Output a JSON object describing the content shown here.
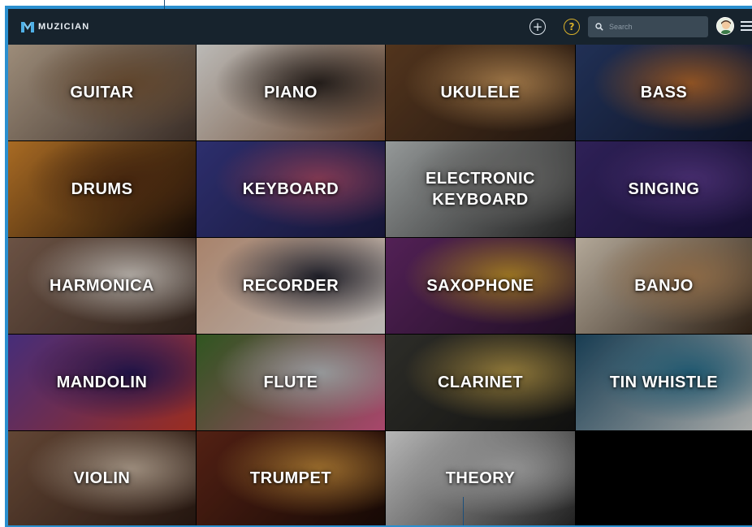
{
  "app": {
    "brand": "MUZICIAN"
  },
  "header": {
    "add_icon": "plus-circle-icon",
    "help_icon": "question-circle-icon",
    "help_glyph": "?",
    "add_glyph": "+",
    "search_placeholder": "Search",
    "menu_icon": "hamburger-menu-icon"
  },
  "colors": {
    "frame": "#2a8fcf",
    "topbar": "#17232d",
    "help": "#d8b02a"
  },
  "instruments": [
    {
      "label": "GUITAR",
      "c1": "#c9b49c",
      "c2": "#7c5a3a",
      "c3": "#4a3a32"
    },
    {
      "label": "PIANO",
      "c1": "#f0eeea",
      "c2": "#2e2622",
      "c3": "#8a5e40"
    },
    {
      "label": "UKULELE",
      "c1": "#6a4426",
      "c2": "#c8955a",
      "c3": "#2a1c14"
    },
    {
      "label": "BASS",
      "c1": "#2a3e6e",
      "c2": "#b76a2e",
      "c3": "#121a30"
    },
    {
      "label": "DRUMS",
      "c1": "#d8892e",
      "c2": "#5a3214",
      "c3": "#1c0f08"
    },
    {
      "label": "KEYBOARD",
      "c1": "#3a3c8c",
      "c2": "#a64a6a",
      "c3": "#1c1c46"
    },
    {
      "label": "ELECTRONIC\nKEYBOARD",
      "c1": "#bfc4c4",
      "c2": "#7c7c7a",
      "c3": "#2a2a2a"
    },
    {
      "label": "SINGING",
      "c1": "#3c2a70",
      "c2": "#5a3a8c",
      "c3": "#1c1440"
    },
    {
      "label": "HARMONICA",
      "c1": "#8a6a58",
      "c2": "#e0d8d0",
      "c3": "#3a2a22"
    },
    {
      "label": "RECORDER",
      "c1": "#d8a88a",
      "c2": "#2a2a36",
      "c3": "#f0ece8"
    },
    {
      "label": "SAXOPHONE",
      "c1": "#6a2a6e",
      "c2": "#c7962e",
      "c3": "#2a1430"
    },
    {
      "label": "BANJO",
      "c1": "#e6d8c4",
      "c2": "#b4885a",
      "c3": "#3a2a1c"
    },
    {
      "label": "MANDOLIN",
      "c1": "#5a3a9c",
      "c2": "#2a1a5c",
      "c3": "#c73a2a"
    },
    {
      "label": "FLUTE",
      "c1": "#3e6e2a",
      "c2": "#c0c4c6",
      "c3": "#d85a8a"
    },
    {
      "label": "CLARINET",
      "c1": "#3a3a34",
      "c2": "#b89a4a",
      "c3": "#161614"
    },
    {
      "label": "TIN WHISTLE",
      "c1": "#1f4e6a",
      "c2": "#2a7290",
      "c3": "#d8dad8"
    },
    {
      "label": "VIOLIN",
      "c1": "#7e5a44",
      "c2": "#c8b4a0",
      "c3": "#2e1c14"
    },
    {
      "label": "TRUMPET",
      "c1": "#6a2a1a",
      "c2": "#c48a3a",
      "c3": "#1c0c06"
    },
    {
      "label": "THEORY",
      "c1": "#eaeaea",
      "c2": "#bcbcbc",
      "c3": "#2a2a2a"
    }
  ]
}
